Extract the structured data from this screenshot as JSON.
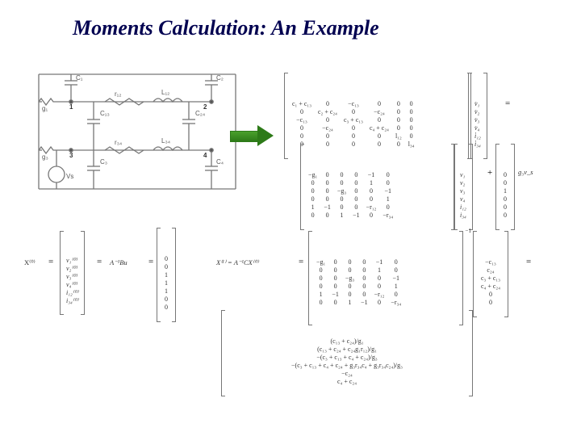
{
  "title": "Moments Calculation: An Example",
  "circuit_labels": {
    "C1": "C₁",
    "C2": "C₂",
    "C13": "C₁₃",
    "C24": "C₂₄",
    "C3": "C₃",
    "C4": "C₄",
    "r12": "r₁₂",
    "r34": "r₃₄",
    "L12": "L₁₂",
    "L34": "L₃₄",
    "g1": "g₁",
    "g3": "g₃",
    "Vs": "Vs",
    "n1": "1",
    "n2": "2",
    "n3": "3",
    "n4": "4"
  },
  "C_matrix": [
    [
      "c₁ + c₁₃",
      "0",
      "−c₁₃",
      "0",
      "0",
      "0"
    ],
    [
      "0",
      "c₂ + c₂₄",
      "0",
      "−c₂₄",
      "0",
      "0"
    ],
    [
      "−c₁₃",
      "0",
      "c₃ + c₁₃",
      "0",
      "0",
      "0"
    ],
    [
      "0",
      "−c₂₄",
      "0",
      "c₄ + c₂₄",
      "0",
      "0"
    ],
    [
      "0",
      "0",
      "0",
      "0",
      "l₁₂",
      "0"
    ],
    [
      "0",
      "0",
      "0",
      "0",
      "0",
      "l₃₄"
    ]
  ],
  "xdot": [
    "v̇₁",
    "v̇₂",
    "v̇₃",
    "v̇₄",
    "i̇₁₂",
    "i̇₃₄"
  ],
  "G_matrix": [
    [
      "−g₁",
      "0",
      "0",
      "0",
      "−1",
      "0"
    ],
    [
      "0",
      "0",
      "0",
      "0",
      "1",
      "0"
    ],
    [
      "0",
      "0",
      "−g₃",
      "0",
      "0",
      "−1"
    ],
    [
      "0",
      "0",
      "0",
      "0",
      "0",
      "1"
    ],
    [
      "1",
      "−1",
      "0",
      "0",
      "−r₁₂",
      "0"
    ],
    [
      "0",
      "0",
      "1",
      "−1",
      "0",
      "−r₃₄"
    ]
  ],
  "x": [
    "v₁",
    "v₂",
    "v₃",
    "v₄",
    "i₁₂",
    "i₃₄"
  ],
  "Bu": [
    "0",
    "0",
    "1",
    "0",
    "0",
    "0"
  ],
  "Bu_sym": "g₃v_s",
  "X0_lhs": "X⁽⁰⁾",
  "X0_vec_sym": [
    "v₁⁽⁰⁾",
    "v₂⁽⁰⁾",
    "v₃⁽⁰⁾",
    "v₄⁽⁰⁾",
    "i₁₂⁽⁰⁾",
    "i₃₄⁽⁰⁾"
  ],
  "X0_eq": "A⁻¹Bu",
  "X0_val": [
    "0",
    "0",
    "1",
    "1",
    "1",
    "0",
    "0"
  ],
  "X1_lhs": "X⁽¹⁾ = A⁻¹CX⁽⁰⁾",
  "G_inv_matrix": [
    [
      "−g₁",
      "0",
      "0",
      "0",
      "−1",
      "0"
    ],
    [
      "0",
      "0",
      "0",
      "0",
      "1",
      "0"
    ],
    [
      "0",
      "0",
      "−g₃",
      "0",
      "0",
      "−1"
    ],
    [
      "0",
      "0",
      "0",
      "0",
      "0",
      "1"
    ],
    [
      "1",
      "−1",
      "0",
      "0",
      "−r₁₂",
      "0"
    ],
    [
      "0",
      "0",
      "1",
      "−1",
      "0",
      "−r₃₄"
    ]
  ],
  "CX0": [
    "−c₁₃",
    "c₂₄",
    "c₃ + c₁₃",
    "c₄ + c₂₄",
    "0",
    "0"
  ],
  "X1_result": [
    "(c₁₃ + c₂₄)/g₁",
    "(c₁₃ + c₂₄ + c₂₄g₁r₁₂)/g₁",
    "−(c₃ + c₁₃ + c₄ + c₂₄)/g₃",
    "−(c₃ + c₁₃ + c₄ + c₂₄ + g₃r₃₄c₄ + g₃r₃₄c₂₄)/g₃",
    "−c₂₄",
    "c₄ + c₂₄"
  ]
}
